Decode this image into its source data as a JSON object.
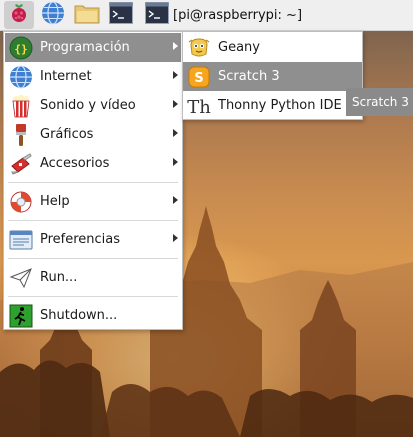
{
  "taskbar": {
    "terminal_task_label": "[pi@raspberrypi: ~]",
    "icons": [
      "raspberry-menu-icon",
      "web-browser-icon",
      "file-manager-icon",
      "terminal-icon"
    ]
  },
  "main_menu": {
    "items": [
      {
        "label": "Programación",
        "icon": "programming-icon",
        "has_submenu": true,
        "selected": true
      },
      {
        "label": "Internet",
        "icon": "globe-icon",
        "has_submenu": true
      },
      {
        "label": "Sonido y vídeo",
        "icon": "popcorn-icon",
        "has_submenu": true
      },
      {
        "label": "Gráficos",
        "icon": "paintbrush-icon",
        "has_submenu": true
      },
      {
        "label": "Accesorios",
        "icon": "swiss-knife-icon",
        "has_submenu": true
      },
      {
        "label": "Help",
        "icon": "lifebuoy-icon",
        "has_submenu": true
      },
      {
        "label": "Preferencias",
        "icon": "preferences-icon",
        "has_submenu": true
      },
      {
        "label": "Run...",
        "icon": "paper-plane-icon",
        "has_submenu": false
      },
      {
        "label": "Shutdown...",
        "icon": "exit-icon",
        "has_submenu": false
      }
    ]
  },
  "sub_menu": {
    "items": [
      {
        "label": "Geany",
        "icon": "geany-icon"
      },
      {
        "label": "Scratch 3",
        "icon": "scratch-icon",
        "selected": true
      },
      {
        "label": "Thonny Python IDE",
        "icon": "thonny-icon"
      }
    ]
  },
  "tooltip": {
    "text": "Scratch 3"
  },
  "colors": {
    "panel_bg": "#efefef",
    "menu_bg": "#ffffff",
    "selection_bg": "#8f8f8f",
    "tooltip_bg": "#8a8a8a"
  }
}
